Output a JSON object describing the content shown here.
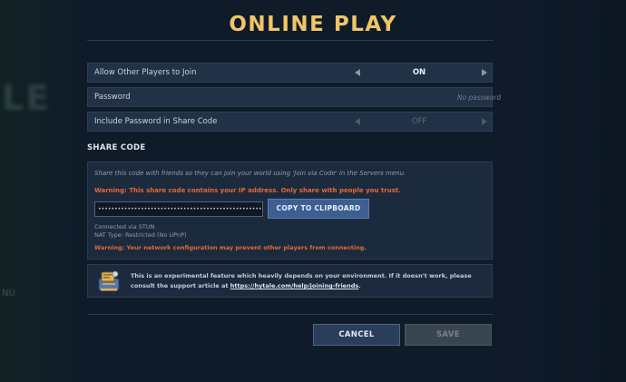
{
  "page": {
    "title": "ONLINE PLAY"
  },
  "background": {
    "left_text": "LE",
    "left_small_text": "NU"
  },
  "settings": [
    {
      "label": "Allow Other Players to Join",
      "value": "ON",
      "kind": "toggle",
      "enabled": true
    },
    {
      "label": "Password",
      "placeholder": "No password",
      "kind": "input"
    },
    {
      "label": "Include Password in Share Code",
      "value": "OFF",
      "kind": "toggle",
      "enabled": false
    }
  ],
  "share_code": {
    "title": "SHARE CODE",
    "description": "Share this code with friends so they can join your world using 'Join via Code' in the Servers menu.",
    "warning_ip": "Warning: This share code contains your IP address. Only share with people you trust.",
    "code_value": "••••••••••••••••••••••••••••••••••••••••••••••••••••••••••",
    "copy_button": "COPY TO CLIPBOARD",
    "connection": "Connected via STUN",
    "nat_type": "NAT Type: Restricted (No UPnP)",
    "warning_network": "Warning: Your network configuration may prevent other players from connecting."
  },
  "info": {
    "text_before": "This is an experimental feature which heavily depends on your environment. If it doesn't work, please consult the support article at ",
    "link": "https://hytale.com/help/joining-friends",
    "text_after": ".",
    "icon": "scroll-book-icon"
  },
  "actions": {
    "cancel": "CANCEL",
    "save": "SAVE"
  },
  "colors": {
    "title": "#f1c566",
    "warning": "#e26a3a",
    "primary_button": "#3c5f92",
    "background": "#101b2a"
  }
}
